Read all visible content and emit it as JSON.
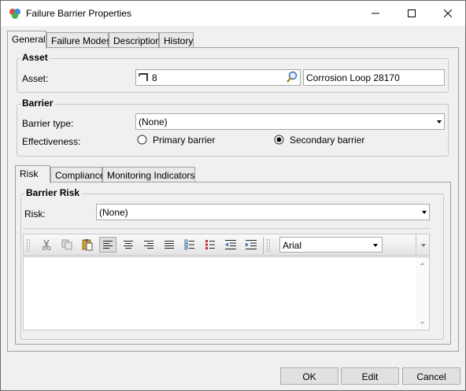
{
  "window": {
    "title": "Failure Barrier Properties",
    "controls": {
      "minimize": "minimize",
      "maximize": "maximize",
      "close": "close"
    }
  },
  "main_tabs": [
    {
      "label": "General",
      "active": true
    },
    {
      "label": "Failure Modes",
      "active": false
    },
    {
      "label": "Description",
      "active": false
    },
    {
      "label": "History",
      "active": false
    }
  ],
  "asset_group": {
    "title": "Asset",
    "asset_label": "Asset:",
    "asset_value": "8",
    "asset_description": "Corrosion Loop 28170"
  },
  "barrier_group": {
    "title": "Barrier",
    "type_label": "Barrier type:",
    "type_value": "(None)",
    "effectiveness_label": "Effectiveness:",
    "options": [
      {
        "label": "Primary barrier",
        "selected": false
      },
      {
        "label": "Secondary barrier",
        "selected": true
      }
    ]
  },
  "sub_tabs": [
    {
      "label": "Risk",
      "active": true
    },
    {
      "label": "Compliance",
      "active": false
    },
    {
      "label": "Monitoring Indicators",
      "active": false
    }
  ],
  "risk_group": {
    "title": "Barrier Risk",
    "risk_label": "Risk:",
    "risk_value": "(None)"
  },
  "editor_toolbar": {
    "buttons": [
      "cut-icon",
      "copy-icon",
      "paste-icon",
      "align-left-icon",
      "align-center-icon",
      "align-right-icon",
      "justify-icon",
      "bullet-list-icon",
      "numbered-list-icon",
      "outdent-icon",
      "indent-icon"
    ],
    "font_value": "Arial"
  },
  "footer": {
    "ok_label": "OK",
    "edit_label": "Edit",
    "cancel_label": "Cancel"
  }
}
